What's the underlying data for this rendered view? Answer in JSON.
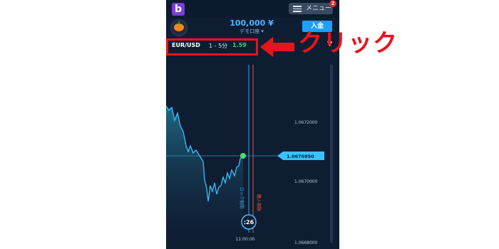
{
  "header": {
    "logo_letter": "b",
    "menu_label": "メニュー",
    "notification_count": "2"
  },
  "account": {
    "balance": "100,000 ¥",
    "account_type": "デモ口座 ▾",
    "deposit_label": "入金"
  },
  "asset": {
    "pair": "EUR/USD",
    "timeframe": "1 - 5分",
    "payout": "1.59"
  },
  "chart_data": {
    "type": "line",
    "price_ticks": [
      "1.0672000",
      "1.0670000",
      "1.0668000"
    ],
    "current_price": "1.0670850",
    "entry_line_label": "購入期限",
    "expiry_line_label": "ロック期間",
    "timer": ":26",
    "time_label": "11:00:00"
  },
  "annotation": {
    "text": "クリック",
    "color": "#e8141c"
  },
  "colors": {
    "background": "#0f1d33",
    "accent": "#1aa0ff",
    "payout": "#3fd36b"
  }
}
